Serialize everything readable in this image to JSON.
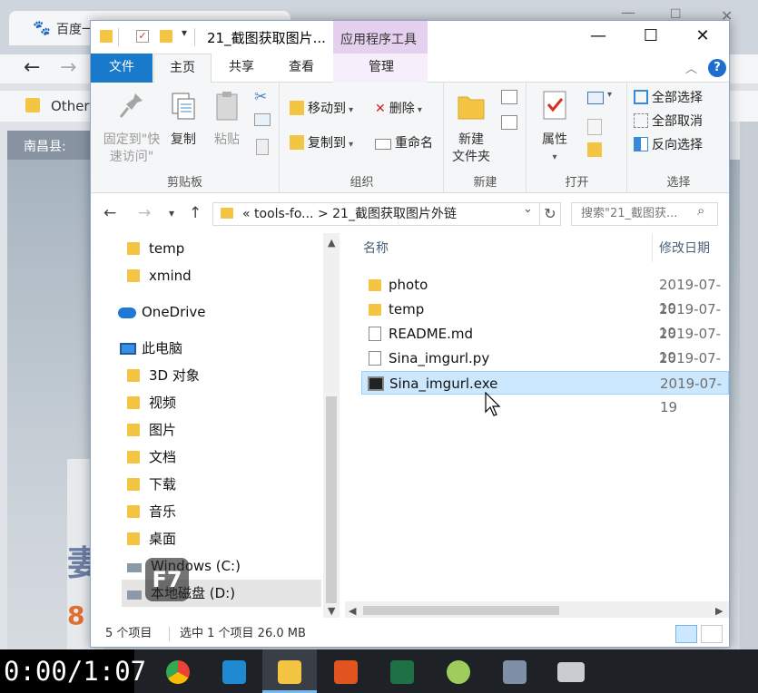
{
  "background_browser": {
    "tab_title": "百度一",
    "bookmark": "Other",
    "nav_label": "南昌县:",
    "big_char": "妻",
    "big_digit": "8"
  },
  "titlebar": {
    "title": "21_截图获取图片...",
    "app_tools": "应用程序工具",
    "minimize": "—",
    "maximize": "☐",
    "close": "✕"
  },
  "tabs": {
    "file": "文件",
    "home": "主页",
    "share": "共享",
    "view": "查看",
    "manage": "管理"
  },
  "ribbon": {
    "clipboard": {
      "pin_label": "固定到\"快速访问\"",
      "copy": "复制",
      "paste": "粘贴",
      "group": "剪贴板"
    },
    "organize": {
      "move_to": "移动到",
      "copy_to": "复制到",
      "delete": "删除",
      "rename": "重命名",
      "group": "组织"
    },
    "new": {
      "new_folder": "新建\n文件夹",
      "group": "新建"
    },
    "open": {
      "properties": "属性",
      "group": "打开"
    },
    "select": {
      "select_all": "全部选择",
      "select_none": "全部取消",
      "invert": "反向选择",
      "group": "选择"
    }
  },
  "address": {
    "crumbs_prefix": "«",
    "crumb1": "tools-fo...",
    "crumb_sep": ">",
    "crumb2": "21_截图获取图片外链",
    "search_placeholder": "搜索\"21_截图获..."
  },
  "nav": {
    "items": [
      {
        "label": "temp",
        "icon": "folder-icon"
      },
      {
        "label": "xmind",
        "icon": "folder-icon"
      },
      {
        "label": "OneDrive",
        "icon": "onedrive-icon"
      },
      {
        "label": "此电脑",
        "icon": "computer-icon"
      },
      {
        "label": "3D 对象",
        "icon": "3d-objects-icon"
      },
      {
        "label": "视频",
        "icon": "videos-icon"
      },
      {
        "label": "图片",
        "icon": "pictures-icon"
      },
      {
        "label": "文档",
        "icon": "documents-icon"
      },
      {
        "label": "下载",
        "icon": "downloads-icon"
      },
      {
        "label": "音乐",
        "icon": "music-icon"
      },
      {
        "label": "桌面",
        "icon": "desktop-icon"
      },
      {
        "label": "Windows (C:)",
        "icon": "drive-icon"
      },
      {
        "label": "本地磁盘 (D:)",
        "icon": "drive-icon"
      }
    ]
  },
  "files": {
    "col_name": "名称",
    "col_date": "修改日期",
    "rows": [
      {
        "name": "photo",
        "date": "2019-07-19",
        "type": "folder"
      },
      {
        "name": "temp",
        "date": "2019-07-19",
        "type": "folder"
      },
      {
        "name": "README.md",
        "date": "2019-07-19",
        "type": "doc"
      },
      {
        "name": "Sina_imgurl.py",
        "date": "2019-07-19",
        "type": "doc"
      },
      {
        "name": "Sina_imgurl.exe",
        "date": "2019-07-19",
        "type": "exe",
        "selected": true
      }
    ]
  },
  "status": {
    "count": "5 个项目",
    "selection": "选中 1 个项目  26.0 MB"
  },
  "overlay": {
    "badge": "F7"
  },
  "taskbar": {
    "timer": "0:00/1:07",
    "apps": [
      "chrome-icon",
      "vscode-icon",
      "file-explorer-icon",
      "xmind-icon",
      "excel-icon",
      "wechat-icon",
      "snip-icon",
      "switch-icon"
    ]
  }
}
